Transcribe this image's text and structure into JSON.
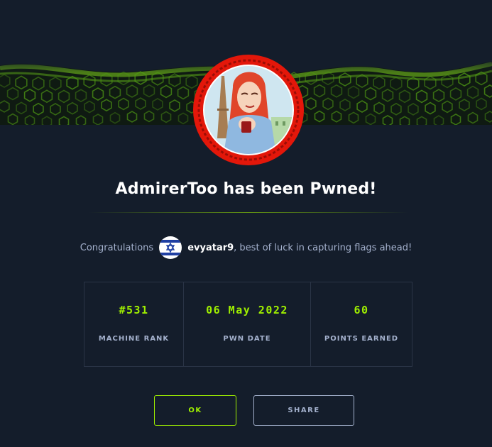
{
  "modal": {
    "title": "AdmirerToo has been Pwned!",
    "congrats_prefix": "Congratulations",
    "username": "evyatar9",
    "congrats_suffix": ", best of luck in capturing flags ahead!"
  },
  "stats": [
    {
      "value": "#531",
      "label": "MACHINE RANK"
    },
    {
      "value": "06 May 2022",
      "label": "PWN DATE"
    },
    {
      "value": "60",
      "label": "POINTS EARNED"
    }
  ],
  "buttons": {
    "ok_label": "OK",
    "share_label": "SHARE"
  },
  "icons": {
    "avatar": "machine-avatar-icon",
    "flag": "israel-flag-icon"
  },
  "colors": {
    "background": "#141d2b",
    "accent": "#9fef00",
    "muted": "#a4b1cd",
    "ring": "#e3170a"
  }
}
